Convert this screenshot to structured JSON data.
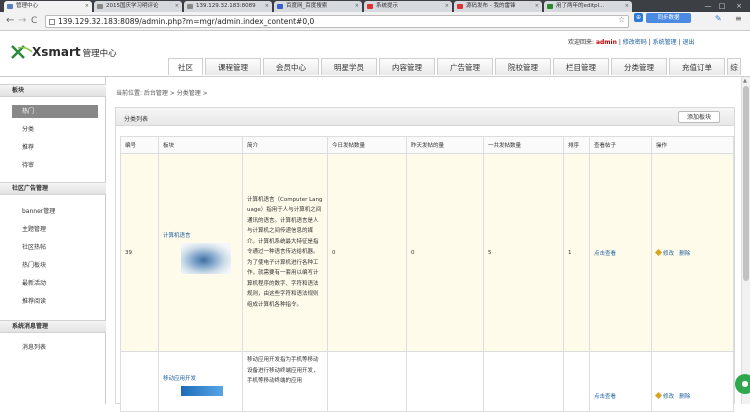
{
  "browser": {
    "tabs": [
      {
        "label": "管理中心",
        "active": true,
        "color": "#5a7fbf"
      },
      {
        "label": "2015国庆学习明评论",
        "active": false,
        "color": "#888"
      },
      {
        "label": "139.129.32.183:8089",
        "active": false,
        "color": "#888"
      },
      {
        "label": "139.129.32.183:808",
        "active": false,
        "color": "#888"
      },
      {
        "label": "百度网_百度搜索",
        "active": false,
        "color": "#3a5fcd"
      },
      {
        "label": "系统提示",
        "active": false,
        "color": "#d33"
      },
      {
        "label": "源码发布 - 我的雷锋",
        "active": false,
        "color": "#d33"
      },
      {
        "label": "用了两年的editpl...",
        "active": false,
        "color": "#2a8a2a"
      }
    ],
    "tab_close": "×",
    "window_controls": [
      "—",
      "□",
      "×"
    ],
    "back": "←",
    "forward": "→",
    "reload": "C",
    "url": "139.129.32.183:8089/admin.php?m=mgr/admin.index_content#0,0",
    "star": "☆",
    "ext1_label": "⊕",
    "sync_label": "同步数据",
    "menu_icon": "≡",
    "ext2_label": "✎"
  },
  "header": {
    "logo_brand": "Xsmart",
    "logo_sub": "管理中心",
    "welcome": "欢迎回来:",
    "username": "admin",
    "sep": "|",
    "link_modify_pwd": "修改密码",
    "link_system": "系统管理",
    "link_logout": "退出"
  },
  "nav": {
    "items": [
      "社区",
      "课程管理",
      "会员中心",
      "明星学员",
      "内容管理",
      "广告管理",
      "院校管理",
      "栏目管理",
      "分类管理",
      "充值订单",
      "综"
    ],
    "active_index": 0
  },
  "sidebar": {
    "sections": [
      {
        "title": "板块",
        "items": [
          "热门",
          "分类",
          "推荐",
          "待审"
        ]
      },
      {
        "title": "社区广告管理",
        "items": [
          "banner管理",
          "主题管理",
          "社区热帖",
          "热门板块",
          "最新活动",
          "推荐阅读"
        ]
      },
      {
        "title": "系统消息管理",
        "items": [
          "消息列表"
        ]
      }
    ],
    "active_item": "热门"
  },
  "breadcrumb": "当前位置: 后台管理 > 分类管理 >",
  "panel": {
    "title": "分类列表",
    "add_button": "添加板块"
  },
  "table": {
    "headers": [
      "编号",
      "板块",
      "简介",
      "今日发帖数量",
      "昨天发帖的量",
      "一共发帖数量",
      "排序",
      "查看帖子",
      "操作"
    ],
    "rows": [
      {
        "id": "39",
        "name": "计算机语言",
        "intro": "计算机语言（Computer Language）指用于人与计算机之间通讯的语言。计算机语言是人与计算机之间传递信息的媒介。计算机系统最大特征是指令通过一种语言传达给机器。为了使电子计算机进行各种工作，就需要有一套用以编写计算机程序的数字、字符和语法规则，由这些字符和语法规则组成计算机各种指令。",
        "today": "0",
        "yesterday": "0",
        "total": "5",
        "sort": "1",
        "view": "点击查看",
        "edit": "修改",
        "delete": "删除"
      },
      {
        "id": "",
        "name": "移动应用开发",
        "intro": "移动应用开发指为手机等移动设备进行移动终端应用开发，手机等移动终端的应用",
        "today": "",
        "yesterday": "",
        "total": "",
        "sort": "",
        "view": "点击查看",
        "edit": "修改",
        "delete": "删除"
      }
    ]
  }
}
